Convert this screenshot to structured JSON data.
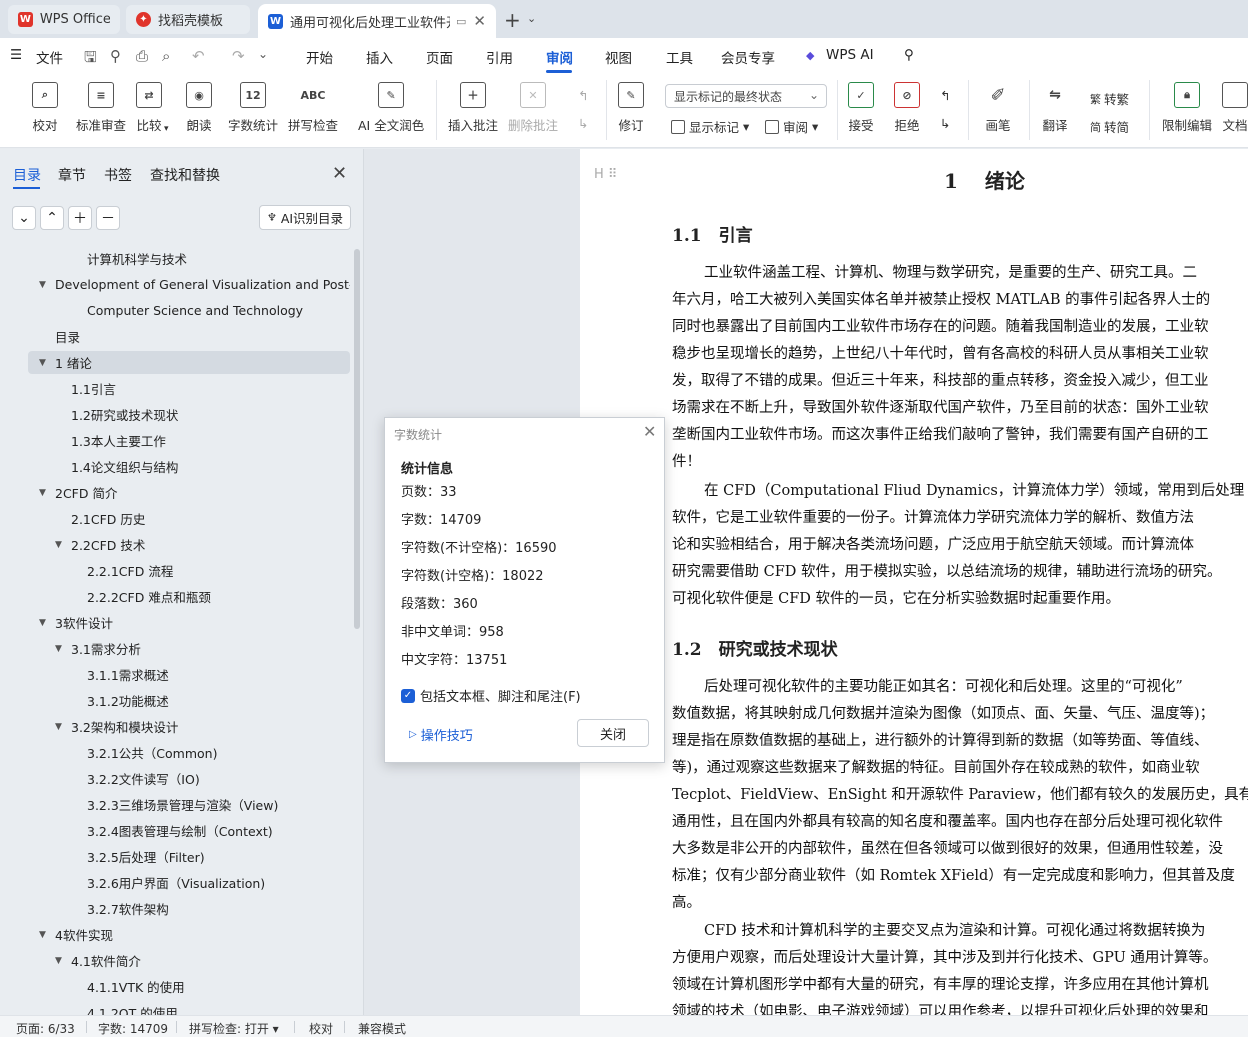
{
  "tabs": [
    {
      "label": "WPS Office",
      "icon": "wps-logo-icon",
      "color": "#e0342b"
    },
    {
      "label": "找稻壳模板",
      "icon": "docer-icon",
      "color": "#e0342b"
    },
    {
      "label": "通用可视化后处理工业软件开",
      "icon": "writer-doc-icon",
      "color": "#1c5fd6"
    }
  ],
  "menu": {
    "file": "文件",
    "items": [
      "开始",
      "插入",
      "页面",
      "引用",
      "审阅",
      "视图",
      "工具",
      "会员专享",
      "WPS AI"
    ],
    "selected": "审阅",
    "accent": "#1c5fd6"
  },
  "ribbon": {
    "proofread": "校对",
    "std_review": "标准审查",
    "compare": "比较",
    "read_aloud": "朗读",
    "word_count": "字数统计",
    "spell_check": "拼写检查",
    "ai_proof": "AI 全文润色",
    "insert_comment": "插入批注",
    "delete_comment": "删除批注",
    "track_changes": "修订",
    "mode_select": "显示标记的最终状态",
    "show_markup": "显示标记",
    "review": "审阅",
    "accept": "接受",
    "reject": "拒绝",
    "brush": "画笔",
    "translate": "翻译",
    "to_traditional": "转繁",
    "to_simplified": "转简",
    "restrict_edit": "限制编辑",
    "doc_rights": "文档"
  },
  "nav": {
    "tabs": [
      "目录",
      "章节",
      "书签",
      "查找和替换"
    ],
    "ai_toc": "AI识别目录",
    "items": [
      {
        "label": "计算机科学与技术",
        "level": 3,
        "tri": ""
      },
      {
        "label": "Development of General Visualization and Post-...",
        "level": 1,
        "tri": "▼"
      },
      {
        "label": "Computer Science and Technology",
        "level": 3,
        "tri": ""
      },
      {
        "label": "目录",
        "level": 1,
        "tri": ""
      },
      {
        "label": "1 绪论",
        "level": 1,
        "tri": "▼"
      },
      {
        "label": "1.1引言",
        "level": 2,
        "tri": ""
      },
      {
        "label": "1.2研究或技术现状",
        "level": 2,
        "tri": ""
      },
      {
        "label": "1.3本人主要工作",
        "level": 2,
        "tri": ""
      },
      {
        "label": "1.4论文组织与结构",
        "level": 2,
        "tri": ""
      },
      {
        "label": "2CFD 简介",
        "level": 1,
        "tri": "▼"
      },
      {
        "label": "2.1CFD 历史",
        "level": 2,
        "tri": ""
      },
      {
        "label": "2.2CFD 技术",
        "level": 2,
        "tri": "▼"
      },
      {
        "label": "2.2.1CFD 流程",
        "level": 3,
        "tri": ""
      },
      {
        "label": "2.2.2CFD 难点和瓶颈",
        "level": 3,
        "tri": ""
      },
      {
        "label": "3软件设计",
        "level": 1,
        "tri": "▼"
      },
      {
        "label": "3.1需求分析",
        "level": 2,
        "tri": "▼"
      },
      {
        "label": "3.1.1需求概述",
        "level": 3,
        "tri": ""
      },
      {
        "label": "3.1.2功能概述",
        "level": 3,
        "tri": ""
      },
      {
        "label": "3.2架构和模块设计",
        "level": 2,
        "tri": "▼"
      },
      {
        "label": "3.2.1公共（Common)",
        "level": 3,
        "tri": ""
      },
      {
        "label": "3.2.2文件读写（IO)",
        "level": 3,
        "tri": ""
      },
      {
        "label": "3.2.3三维场景管理与渲染（View)",
        "level": 3,
        "tri": ""
      },
      {
        "label": "3.2.4图表管理与绘制（Context)",
        "level": 3,
        "tri": ""
      },
      {
        "label": "3.2.5后处理（Filter)",
        "level": 3,
        "tri": ""
      },
      {
        "label": "3.2.6用户界面（Visualization)",
        "level": 3,
        "tri": ""
      },
      {
        "label": "3.2.7软件架构",
        "level": 3,
        "tri": ""
      },
      {
        "label": "4软件实现",
        "level": 1,
        "tri": "▼"
      },
      {
        "label": "4.1软件简介",
        "level": 2,
        "tri": "▼"
      },
      {
        "label": "4.1.1VTK 的使用",
        "level": 3,
        "tri": ""
      },
      {
        "label": "4.1.2QT 的使用",
        "level": 3,
        "tri": ""
      }
    ],
    "selected_index": 4
  },
  "document": {
    "h1": "1　 绪论",
    "h2_1": "1.1　引言",
    "h2_2": "1.2　研究或技术现状",
    "para1": [
      "工业软件涵盖工程、计算机、物理与数学研究，是重要的生产、研究工具。二",
      "年六月，哈工大被列入美国实体名单并被禁止授权  MATLAB 的事件引起各界人士的",
      "同时也暴露出了目前国内工业软件市场存在的问题。随着我国制造业的发展，工业软",
      "稳步也呈现增长的趋势，上世纪八十年代时，曾有各高校的科研人员从事相关工业软",
      "发，取得了不错的成果。但近三十年来，科技部的重点转移，资金投入减少，但工业",
      "场需求在不断上升，导致国外软件逐渐取代国产软件，乃至目前的状态：国外工业软",
      "垄断国内工业软件市场。而这次事件正给我们敲响了警钟，我们需要有国产自研的工",
      "件！"
    ],
    "para2": [
      "在 CFD（Computational Fliud Dynamics，计算流体力学）领域，常用到后处理",
      "软件，它是工业软件重要的一份子。计算流体力学研究流体力学的解析、数值方法",
      "论和实验相结合，用于解决各类流场问题，广泛应用于航空航天领域。而计算流体",
      "研究需要借助  CFD 软件，用于模拟实验，以总结流场的规律，辅助进行流场的研究。",
      "可视化软件便是  CFD 软件的一员，它在分析实验数据时起重要作用。"
    ],
    "para3": [
      "后处理可视化软件的主要功能正如其名：可视化和后处理。这里的“可视化”",
      "数值数据，将其映射成几何数据并渲染为图像（如顶点、面、矢量、气压、温度等)；",
      "理是指在原数值数据的基础上，进行额外的计算得到新的数据（如等势面、等值线、",
      "等)，通过观察这些数据来了解数据的特征。目前国外存在较成熟的软件，如商业软",
      "Tecplot、FieldView、EnSight 和开源软件  Paraview，他们都有较久的发展历史，具有",
      "通用性，且在国内外都具有较高的知名度和覆盖率。国内也存在部分后处理可视化软件",
      "大多数是非公开的内部软件，虽然在但各领域可以做到很好的效果，但通用性较差，没",
      "标准；仅有少部分商业软件（如 Romtek XField）有一定完成度和影响力，但其普及度",
      "高。"
    ],
    "para4": [
      "CFD 技术和计算机科学的主要交叉点为渲染和计算。可视化通过将数据转换为",
      "方便用户观察，而后处理设计大量计算，其中涉及到并行化技术、GPU 通用计算等。",
      "领域在计算机图形学中都有大量的研究，有丰厚的理论支撑，许多应用在其他计算机",
      "领域的技术（如电影、电子游戏领域）可以用作参考，以提升可视化后处理的效果和"
    ]
  },
  "dialog": {
    "title": "字数统计",
    "heading": "统计信息",
    "stats": [
      {
        "label": "页数：",
        "value": "33"
      },
      {
        "label": "字数：",
        "value": "14709"
      },
      {
        "label": "字符数(不计空格)：",
        "value": "16590"
      },
      {
        "label": "字符数(计空格)：",
        "value": "18022"
      },
      {
        "label": "段落数：",
        "value": "360"
      },
      {
        "label": "非中文单词：",
        "value": "958"
      },
      {
        "label": "中文字符：",
        "value": "13751"
      }
    ],
    "checkbox_label": "包括文本框、脚注和尾注(F)",
    "checkbox_checked": true,
    "tips": "操作技巧",
    "close": "关闭"
  },
  "status": {
    "page": "页面: 6/33",
    "words": "字数: 14709",
    "spell": "拼写检查: 打开",
    "proof": "校对",
    "compat": "兼容模式"
  }
}
